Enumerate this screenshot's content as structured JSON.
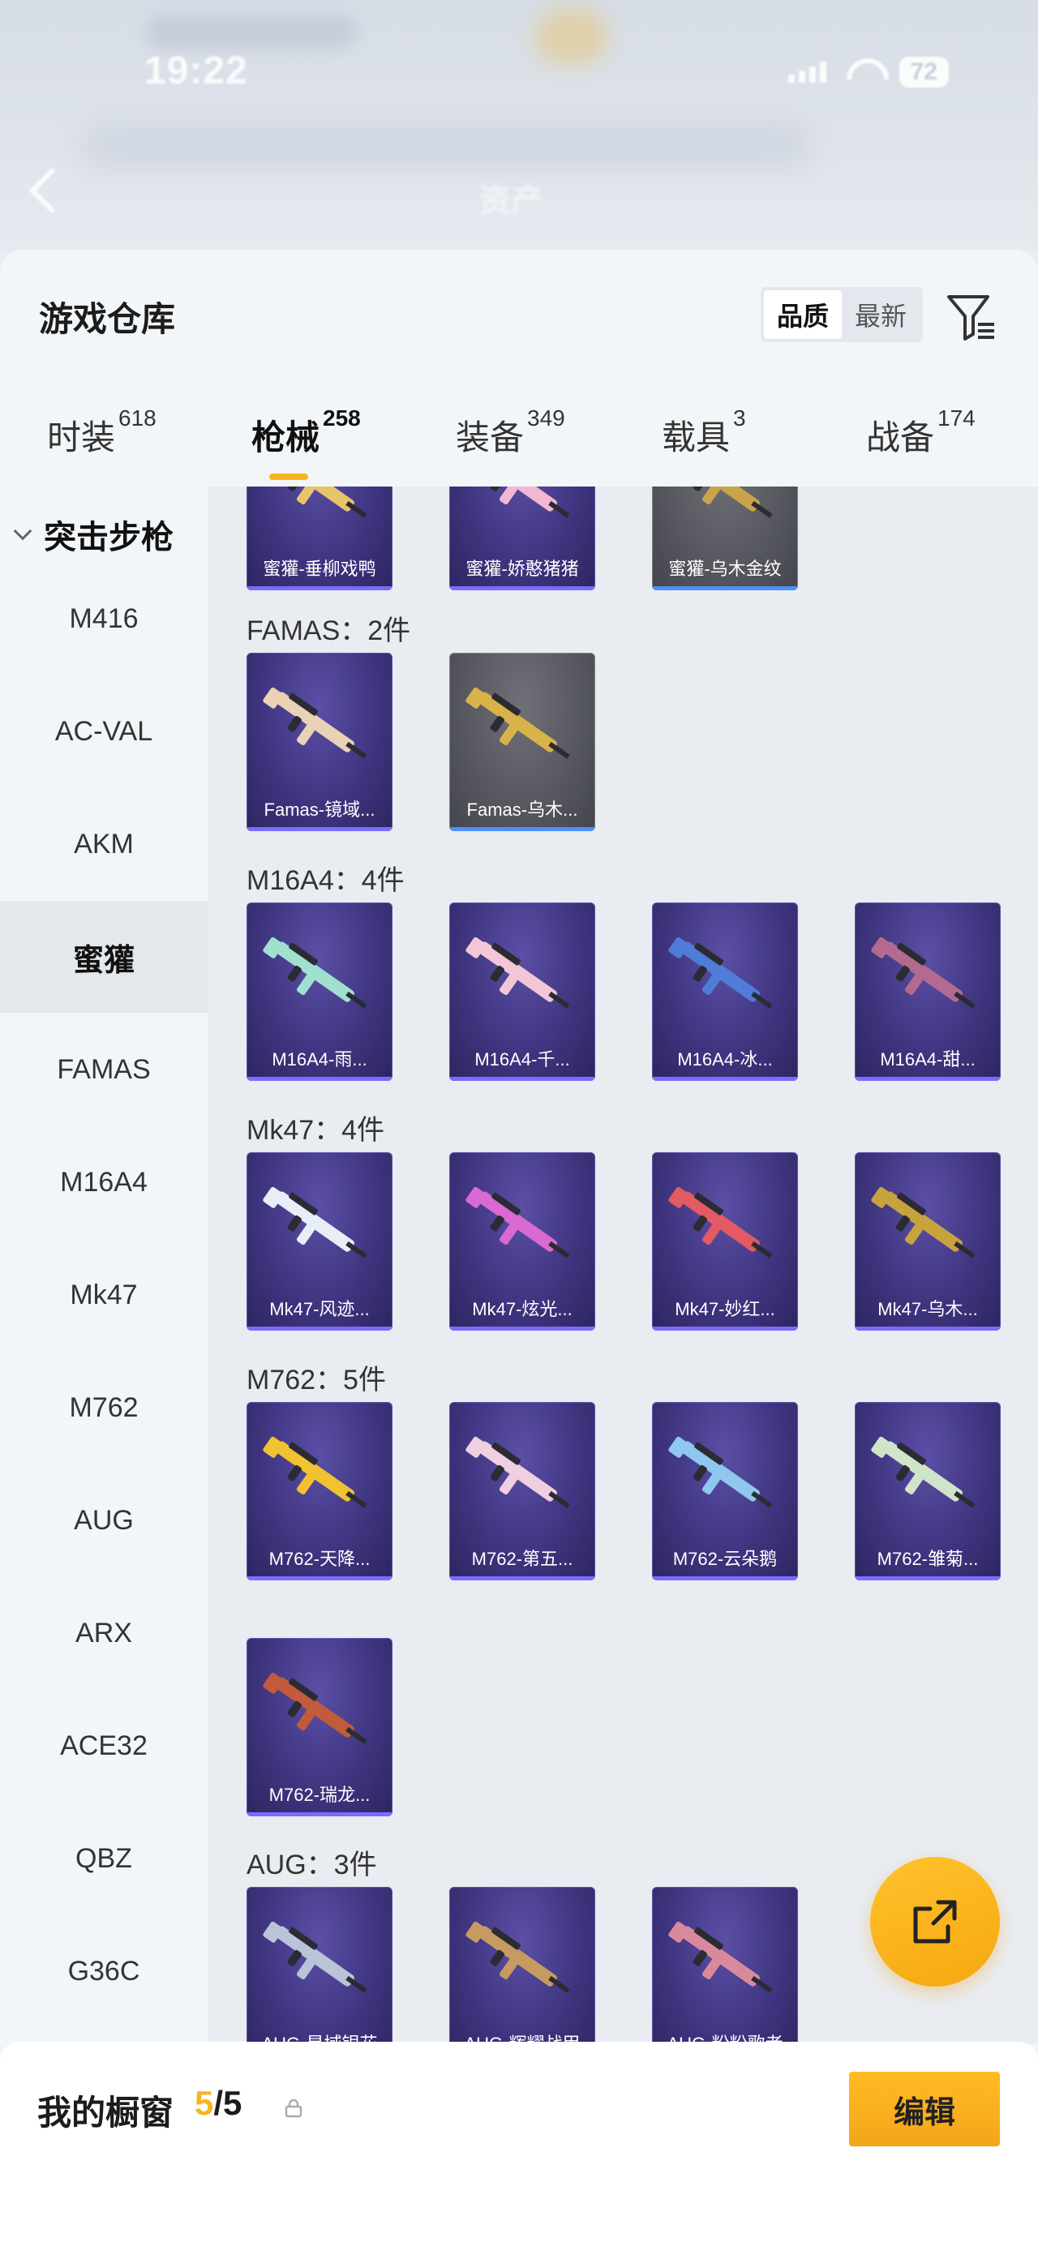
{
  "status": {
    "time": "19:22",
    "battery": "72"
  },
  "header_blur_title": "资产",
  "sheet": {
    "title": "游戏仓库",
    "sort": [
      {
        "label": "品质",
        "active": true
      },
      {
        "label": "最新",
        "active": false
      }
    ]
  },
  "tabs": [
    {
      "label": "时装",
      "count": "618"
    },
    {
      "label": "枪械",
      "count": "258",
      "active": true
    },
    {
      "label": "装备",
      "count": "349"
    },
    {
      "label": "载具",
      "count": "3"
    },
    {
      "label": "战备",
      "count": "174"
    }
  ],
  "sidebar": {
    "group": "突击步枪",
    "items": [
      "M416",
      "AC-VAL",
      "AKM",
      "蜜獾",
      "FAMAS",
      "M16A4",
      "Mk47",
      "M762",
      "AUG",
      "ARX",
      "ACE32",
      "QBZ",
      "G36C"
    ],
    "active": "蜜獾"
  },
  "groups": [
    {
      "title": "",
      "items": [
        {
          "name": "蜜獾-垂柳戏鸭",
          "grey": false
        },
        {
          "name": "蜜獾-娇憨猪猪",
          "grey": false
        },
        {
          "name": "蜜獾-乌木金纹",
          "grey": true
        }
      ]
    },
    {
      "title": "FAMAS：2件",
      "items": [
        {
          "name": "Famas-镜域...",
          "grey": false
        },
        {
          "name": "Famas-乌木...",
          "grey": true
        }
      ]
    },
    {
      "title": "M16A4：4件",
      "items": [
        {
          "name": "M16A4-雨...",
          "grey": false
        },
        {
          "name": "M16A4-千...",
          "grey": false
        },
        {
          "name": "M16A4-冰...",
          "grey": false
        },
        {
          "name": "M16A4-甜...",
          "grey": false
        }
      ]
    },
    {
      "title": "Mk47：4件",
      "items": [
        {
          "name": "Mk47-风迹...",
          "grey": false
        },
        {
          "name": "Mk47-炫光...",
          "grey": false
        },
        {
          "name": "Mk47-妙红...",
          "grey": false
        },
        {
          "name": "Mk47-乌木...",
          "grey": false
        }
      ]
    },
    {
      "title": "M762：5件",
      "items": [
        {
          "name": "M762-天降...",
          "grey": false
        },
        {
          "name": "M762-第五...",
          "grey": false
        },
        {
          "name": "M762-云朵鹅",
          "grey": false
        },
        {
          "name": "M762-雏菊...",
          "grey": false
        },
        {
          "name": "M762-瑞龙...",
          "grey": false
        }
      ]
    },
    {
      "title": "AUG：3件",
      "items": [
        {
          "name": "AUG-星域银花",
          "grey": false
        },
        {
          "name": "AUG-辉耀战甲",
          "grey": false
        },
        {
          "name": "AUG-粉粉歌者",
          "grey": false
        }
      ]
    }
  ],
  "gun_colors": [
    "#e7c46a",
    "#f3b7d3",
    "#c9a44a",
    "#e9d2b5",
    "#d9b349",
    "#9fe0cf",
    "#f2c6d6",
    "#4f7cd6",
    "#b46a8f",
    "#e8eef8",
    "#d86ad1",
    "#e35a63",
    "#c7a33e",
    "#f1c231",
    "#f0cfe1",
    "#8fc7ef",
    "#cfe5c9",
    "#c25a3c",
    "#b9c4d8",
    "#c79a62",
    "#d9899c"
  ],
  "showcase": {
    "title": "我的橱窗",
    "current": "5",
    "total": "/5",
    "edit_label": "编辑"
  }
}
